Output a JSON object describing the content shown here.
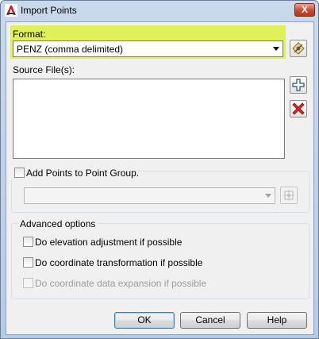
{
  "window": {
    "title": "Import Points",
    "close_glyph": "X",
    "app_icon": "autocad-civil-icon"
  },
  "format": {
    "label": "Format:",
    "selected": "PENZ (comma delimited)",
    "highlight_color": "#dff05a",
    "edit_icon": "point-file-format-manager-icon"
  },
  "source_files": {
    "label": "Source File(s):",
    "items": [],
    "add_icon": "add-plus-icon",
    "remove_icon": "remove-x-icon"
  },
  "point_group": {
    "label": "Add Points to Point Group.",
    "checked": false,
    "selected": "",
    "pick_icon": "create-point-group-icon"
  },
  "advanced": {
    "legend": "Advanced options",
    "options": [
      {
        "label": "Do elevation adjustment if possible",
        "checked": false,
        "enabled": true
      },
      {
        "label": "Do coordinate transformation if possible",
        "checked": false,
        "enabled": true
      },
      {
        "label": "Do coordinate data expansion if possible",
        "checked": false,
        "enabled": false
      }
    ]
  },
  "buttons": {
    "ok": "OK",
    "cancel": "Cancel",
    "help": "Help"
  }
}
